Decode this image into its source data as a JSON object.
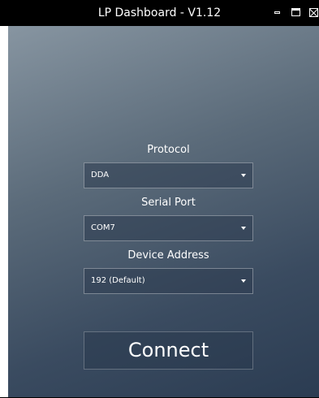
{
  "window": {
    "title": "LP Dashboard - V1.12"
  },
  "form": {
    "protocol": {
      "label": "Protocol",
      "value": "DDA"
    },
    "serial_port": {
      "label": "Serial Port",
      "value": "COM7"
    },
    "device_address": {
      "label": "Device Address",
      "value": "192 (Default)"
    },
    "connect_label": "Connect"
  },
  "icons": {
    "minimize": "minimize-icon",
    "maximize": "maximize-icon",
    "close": "close-icon",
    "dropdown": "caret-down-icon"
  },
  "colors": {
    "titlebar": "#000000",
    "text": "#ffffff",
    "panel_top": "#8795a1",
    "panel_bottom": "#2b3c52"
  }
}
